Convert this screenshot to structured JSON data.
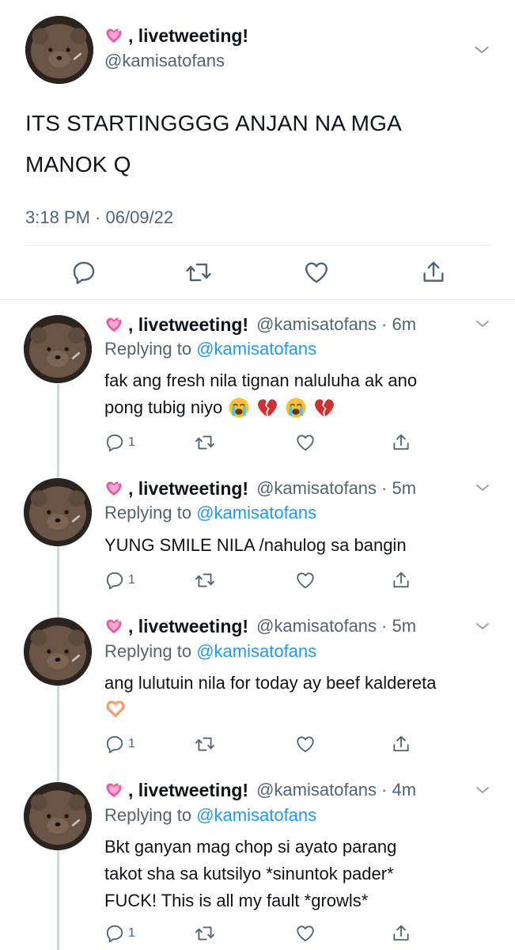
{
  "main_tweet": {
    "display_name": ", livetweeting!",
    "handle": "@kamisatofans",
    "text_line1": "ITS STARTINGGGG ANJAN NA MGA",
    "text_line2": "MANOK Q",
    "timestamp": "3:18 PM · 06/09/22",
    "name_emoji": "heart-sparkle-icon"
  },
  "replies": [
    {
      "display_name": ", livetweeting!",
      "handle": "@kamisatofans",
      "time": "· 6m",
      "replying_label": "Replying to",
      "replying_handle": "@kamisatofans",
      "line1": "fak ang fresh nila tignan naluluha ak ano",
      "line2": "pong tubig niyo",
      "emojis": [
        "loudly-crying-icon",
        "broken-heart-icon",
        "loudly-crying-icon",
        "broken-heart-icon"
      ],
      "reply_count": "1"
    },
    {
      "display_name": ", livetweeting!",
      "handle": "@kamisatofans",
      "time": "· 5m",
      "replying_label": "Replying to",
      "replying_handle": "@kamisatofans",
      "line1": "YUNG SMILE NILA /nahulog sa bangin",
      "reply_count": "1"
    },
    {
      "display_name": ", livetweeting!",
      "handle": "@kamisatofans",
      "time": "· 5m",
      "replying_label": "Replying to",
      "replying_handle": "@kamisatofans",
      "line1": "ang lulutuin nila for today ay beef kaldereta",
      "emojis": [
        "heart-hands-icon"
      ],
      "reply_count": "1"
    },
    {
      "display_name": ", livetweeting!",
      "handle": "@kamisatofans",
      "time": "· 4m",
      "replying_label": "Replying to",
      "replying_handle": "@kamisatofans",
      "line1": "Bkt ganyan mag chop si ayato parang",
      "line2": "takot sha sa kutsilyo *sinuntok pader*",
      "line3": "FUCK! This is all my fault *growls*",
      "reply_count": "1"
    }
  ],
  "colors": {
    "text": "#0f1419",
    "secondary": "#536471",
    "link": "#1d9bf0",
    "divider": "#e6ecf0",
    "thread_line": "#cfd9de",
    "heart_emoji": "#e85aa3"
  }
}
